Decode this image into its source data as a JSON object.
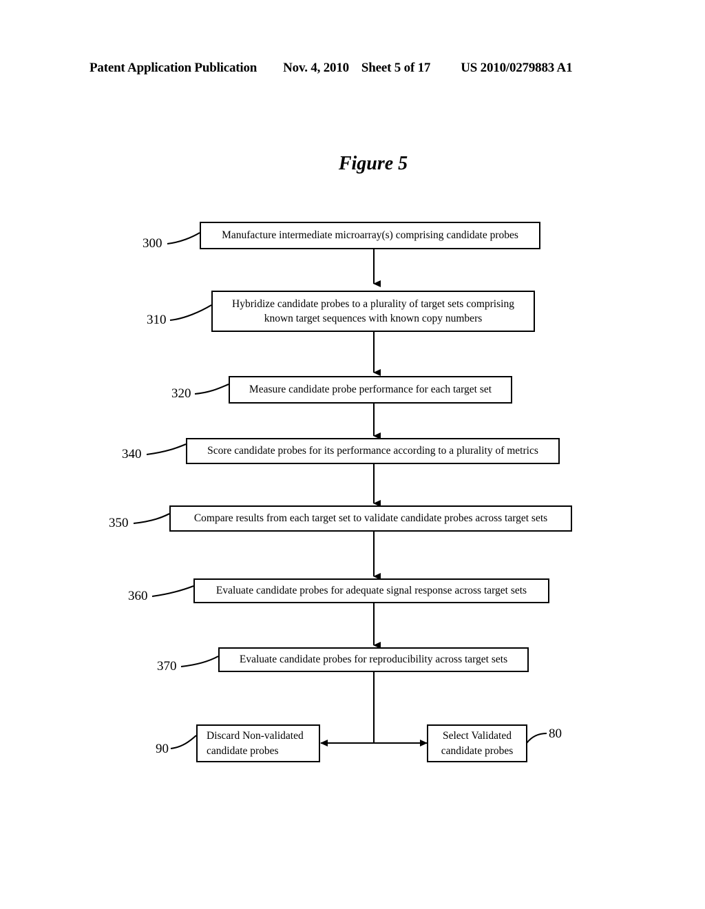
{
  "header": {
    "publication": "Patent Application Publication",
    "date": "Nov. 4, 2010",
    "sheet": "Sheet 5 of 17",
    "number": "US 2010/0279883 A1"
  },
  "figure": {
    "title": "Figure 5"
  },
  "flowchart": {
    "steps": [
      {
        "ref": "300",
        "line1": "Manufacture intermediate microarray(s) comprising candidate probes",
        "line2": ""
      },
      {
        "ref": "310",
        "line1": "Hybridize candidate probes to a plurality of target sets comprising",
        "line2": "known target sequences with known copy numbers"
      },
      {
        "ref": "320",
        "line1": "Measure candidate probe performance for each target set",
        "line2": ""
      },
      {
        "ref": "340",
        "line1": "Score candidate probes for its performance according to a plurality of metrics",
        "line2": ""
      },
      {
        "ref": "350",
        "line1": "Compare results from each target set to validate candidate probes across target sets",
        "line2": ""
      },
      {
        "ref": "360",
        "line1": "Evaluate candidate probes for adequate signal response across target sets",
        "line2": ""
      },
      {
        "ref": "370",
        "line1": "Evaluate candidate probes for reproducibility  across target sets",
        "line2": ""
      }
    ],
    "outcomes": [
      {
        "ref": "90",
        "line1": "Discard Non-validated",
        "line2": "candidate probes"
      },
      {
        "ref": "80",
        "line1": "Select Validated",
        "line2": "candidate probes"
      }
    ]
  },
  "colors": {
    "ink": "#000000",
    "paper": "#ffffff"
  }
}
